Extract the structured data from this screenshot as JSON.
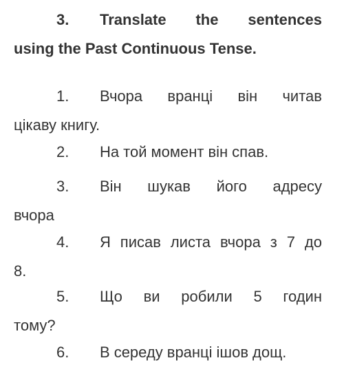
{
  "task": {
    "number": "3.",
    "heading_first_line_words": [
      "Translate",
      "the",
      "sentences"
    ],
    "heading_continuation": "using the Past Continuous Tense."
  },
  "sentences": [
    {
      "number": "1.",
      "first_line_words": [
        "Вчора",
        "вранці",
        "він",
        "читав"
      ],
      "continuation": "цікаву книгу."
    },
    {
      "number": "2.",
      "first_line_words": [
        "На",
        "той",
        "момент",
        "він",
        "спав."
      ],
      "continuation": ""
    },
    {
      "number": "3.",
      "first_line_words": [
        "Він",
        "шукав",
        "його",
        "адресу"
      ],
      "continuation": "вчора"
    },
    {
      "number": "4.",
      "first_line_words": [
        "Я",
        "писав",
        "листа",
        "вчора",
        "з",
        "7",
        "до"
      ],
      "continuation": "8."
    },
    {
      "number": "5.",
      "first_line_words": [
        "Що",
        "ви",
        "робили",
        "5",
        "годин"
      ],
      "continuation": "тому?"
    },
    {
      "number": "6.",
      "first_line_words": [
        "В",
        "середу",
        "вранці",
        "ішов",
        "дощ."
      ],
      "continuation": ""
    }
  ]
}
